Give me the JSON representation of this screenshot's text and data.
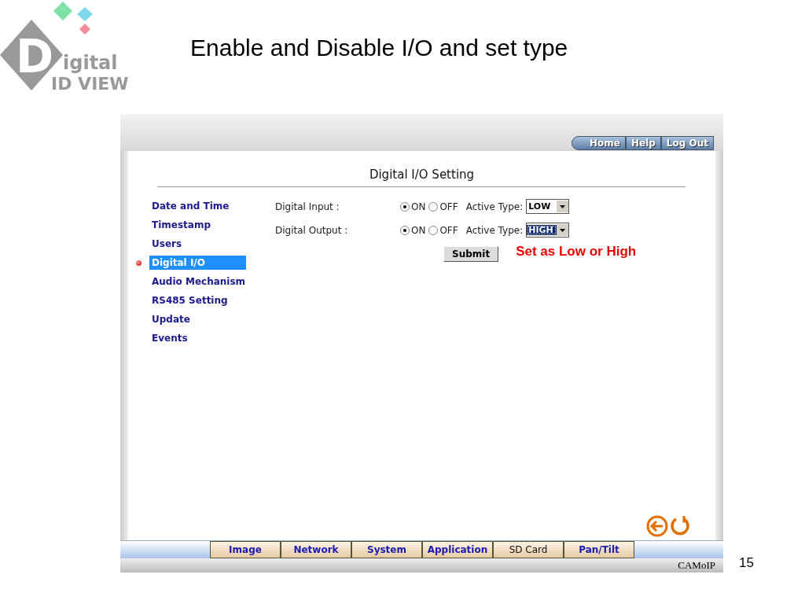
{
  "logo": {
    "letter": "D",
    "line1": "igital",
    "line2": "ID VIEW"
  },
  "slide_title": "Enable and Disable I/O and set type",
  "top_nav": [
    {
      "label": "Home"
    },
    {
      "label": "Help"
    },
    {
      "label": "Log Out"
    }
  ],
  "page_title": "Digital I/O Setting",
  "sidebar": {
    "items": [
      {
        "label": "Date and Time",
        "selected": false
      },
      {
        "label": "Timestamp",
        "selected": false
      },
      {
        "label": "Users",
        "selected": false
      },
      {
        "label": "Digital I/O",
        "selected": true
      },
      {
        "label": "Audio Mechanism",
        "selected": false
      },
      {
        "label": "RS485 Setting",
        "selected": false
      },
      {
        "label": "Update",
        "selected": false
      },
      {
        "label": "Events",
        "selected": false
      }
    ]
  },
  "io_rows": [
    {
      "label": "Digital Input :",
      "on_label": "ON",
      "off_label": "OFF",
      "on": true,
      "type_label": "Active Type:",
      "type_value": "LOW",
      "focused": false
    },
    {
      "label": "Digital Output :",
      "on_label": "ON",
      "off_label": "OFF",
      "on": true,
      "type_label": "Active Type:",
      "type_value": "HIGH",
      "focused": true
    }
  ],
  "submit": "Submit",
  "annotation": "Set as Low or High",
  "bottom_tabs": [
    {
      "label": "Image",
      "selected": false
    },
    {
      "label": "Network",
      "selected": false
    },
    {
      "label": "System",
      "selected": false
    },
    {
      "label": "Application",
      "selected": false
    },
    {
      "label": "SD Card",
      "selected": true
    },
    {
      "label": "Pan/Tilt",
      "selected": false
    }
  ],
  "status_bar": "CAMoIP",
  "page_number": "15"
}
